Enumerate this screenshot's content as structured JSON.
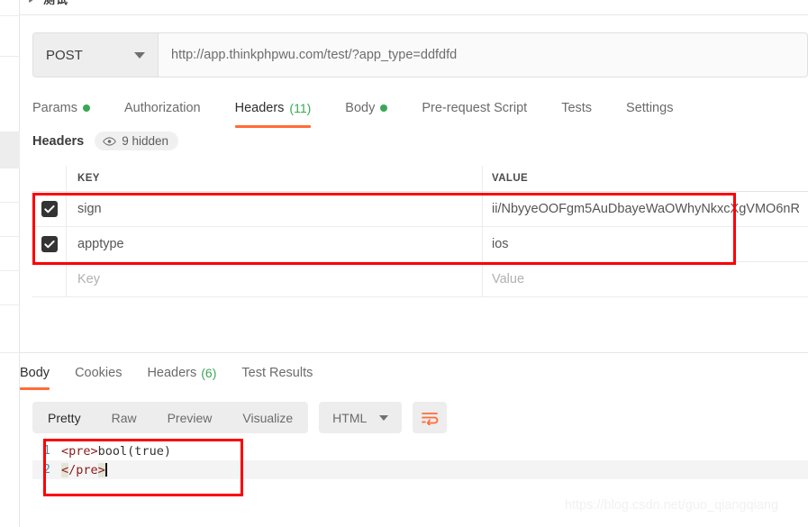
{
  "top_strip": {
    "caret": "▸",
    "label": "测试"
  },
  "request_bar": {
    "method": "POST",
    "method_caret_icon": "chevron-down-icon",
    "url": "http://app.thinkphpwu.com/test/?app_type=ddfdfd"
  },
  "request_tabs": [
    {
      "label": "Params",
      "dot": true,
      "count": "",
      "active": false
    },
    {
      "label": "Authorization",
      "dot": false,
      "count": "",
      "active": false
    },
    {
      "label": "Headers",
      "dot": false,
      "count": "(11)",
      "active": true
    },
    {
      "label": "Body",
      "dot": true,
      "count": "",
      "active": false
    },
    {
      "label": "Pre-request Script",
      "dot": false,
      "count": "",
      "active": false
    },
    {
      "label": "Tests",
      "dot": false,
      "count": "",
      "active": false
    },
    {
      "label": "Settings",
      "dot": false,
      "count": "",
      "active": false
    }
  ],
  "headers_panel": {
    "title": "Headers",
    "hidden_pill": {
      "icon": "eye-icon",
      "label": "9 hidden"
    },
    "columns": {
      "key": "KEY",
      "value": "VALUE"
    },
    "rows": [
      {
        "checked": true,
        "key": "sign",
        "value": "ii/NbyyeOOFgm5AuDbayeWaOWhyNkxcXgVMO6nR"
      },
      {
        "checked": true,
        "key": "apptype",
        "value": "ios"
      }
    ],
    "new_row": {
      "key_placeholder": "Key",
      "value_placeholder": "Value"
    }
  },
  "response_tabs": [
    {
      "label": "Body",
      "count": "",
      "active": true
    },
    {
      "label": "Cookies",
      "count": "",
      "active": false
    },
    {
      "label": "Headers",
      "count": "(6)",
      "active": false
    },
    {
      "label": "Test Results",
      "count": "",
      "active": false
    }
  ],
  "viewer_toolbar": {
    "modes": [
      {
        "label": "Pretty",
        "active": true
      },
      {
        "label": "Raw",
        "active": false
      },
      {
        "label": "Preview",
        "active": false
      },
      {
        "label": "Visualize",
        "active": false
      }
    ],
    "format": "HTML",
    "format_caret_icon": "chevron-down-icon",
    "wrap_icon": "wrap-lines-icon"
  },
  "code": {
    "lines": [
      {
        "num": "1",
        "open_bracket": "<",
        "tag": "pre",
        "close_bracket": ">",
        "text": "bool(true)",
        "highlight": false,
        "cursor": false
      },
      {
        "num": "2",
        "open_bracket": "<",
        "tag": "/pre",
        "close_bracket": ">",
        "text": "",
        "highlight": true,
        "cursor": true
      }
    ]
  },
  "watermark": "https://blog.csdn.net/guo_qiangqiang",
  "colors": {
    "accent_orange": "#ff6c37",
    "green": "#3aa757",
    "annotation_red": "#fb0007",
    "checkbox_dark": "#333333"
  }
}
